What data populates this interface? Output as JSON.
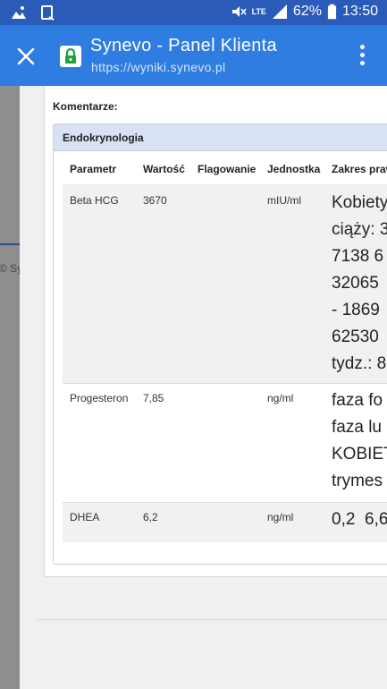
{
  "status_bar": {
    "battery": "62%",
    "time": "13:50",
    "network": "LTE",
    "icons": [
      "image-icon",
      "clipboard-icon",
      "mute-icon",
      "signal-icon",
      "battery-icon"
    ]
  },
  "toolbar": {
    "title": "Synevo - Panel Klienta",
    "url": "https://wyniki.synevo.pl",
    "lock_color": "#1da23f",
    "background": "#2f7de1"
  },
  "page": {
    "footer_copyright": "© Sy",
    "comments_label": "Komentarze:",
    "section_title": "Endokrynologia",
    "columns": [
      "Parametr",
      "Wartość",
      "Flagowanie",
      "Jednostka",
      "Zakres praw"
    ],
    "rows": [
      {
        "parameter": "Beta HCG",
        "value": "3670",
        "flag": "",
        "unit": "mIU/ml",
        "range": "Kobiety\nciąży: 3\n7138 6\n32065\n- 1869\n62530\ntydz.: 8"
      },
      {
        "parameter": "Progesteron",
        "value": "7,85",
        "flag": "",
        "unit": "ng/ml",
        "range": "faza fo\nfaza lu\nKOBIET\ntrymes"
      },
      {
        "parameter": "DHEA",
        "value": "6,2",
        "flag": "",
        "unit": "ng/ml",
        "range": "0,2  6,6"
      }
    ]
  }
}
